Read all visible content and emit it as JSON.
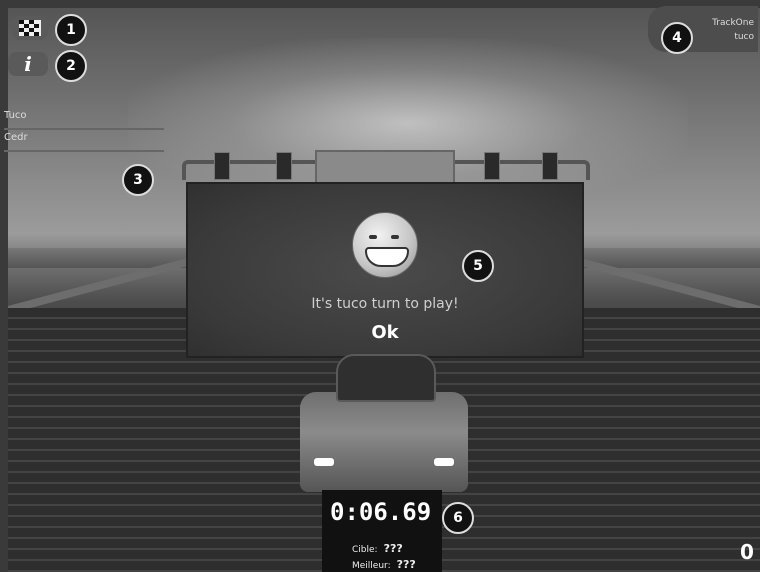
{
  "hud": {
    "track_name": "TrackOne",
    "player_name": "tuco",
    "players": [
      "Tuco",
      "Cedr"
    ],
    "speed": "0"
  },
  "dialog": {
    "message": "It's tuco turn to play!",
    "ok_label": "Ok"
  },
  "timer": {
    "time": "0:06.69",
    "target_label": "Cible:",
    "target_value": "???",
    "best_label": "Meilleur:",
    "best_value": "???"
  },
  "callouts": [
    "1",
    "2",
    "3",
    "4",
    "5",
    "6"
  ],
  "icons": {
    "race": "checkered-flag-icon",
    "info": "info-icon",
    "emotion": "grinning-smiley-icon"
  },
  "colors": {
    "badge_bg": "#111111",
    "badge_border": "#dddddd",
    "panel_bg": "#4d4d4d"
  }
}
